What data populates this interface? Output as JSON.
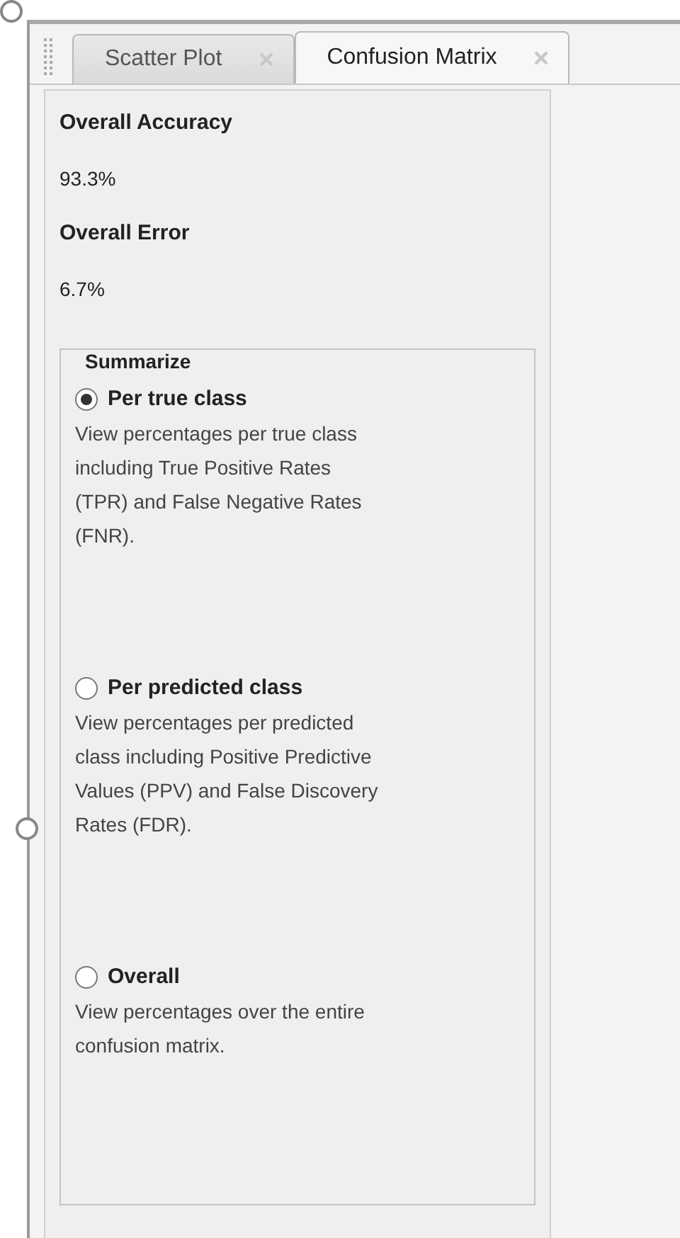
{
  "tabs": [
    {
      "label": "Scatter Plot",
      "selected": false
    },
    {
      "label": "Confusion Matrix",
      "selected": true
    }
  ],
  "stats": [
    {
      "label": "Overall Accuracy",
      "value": "93.3%"
    },
    {
      "label": "Overall Error",
      "value": "6.7%"
    }
  ],
  "summarize": {
    "title": "Summarize",
    "options": [
      {
        "label": "Per true class",
        "description": "View percentages per true class including True Positive Rates (TPR) and False Negative Rates (FNR).",
        "selected": true
      },
      {
        "label": "Per predicted class",
        "description": "View percentages per predicted class including Positive Predictive Values (PPV) and False Discovery Rates (FDR).",
        "selected": false
      },
      {
        "label": "Overall",
        "description": "View percentages over the entire confusion matrix.",
        "selected": false
      }
    ]
  }
}
